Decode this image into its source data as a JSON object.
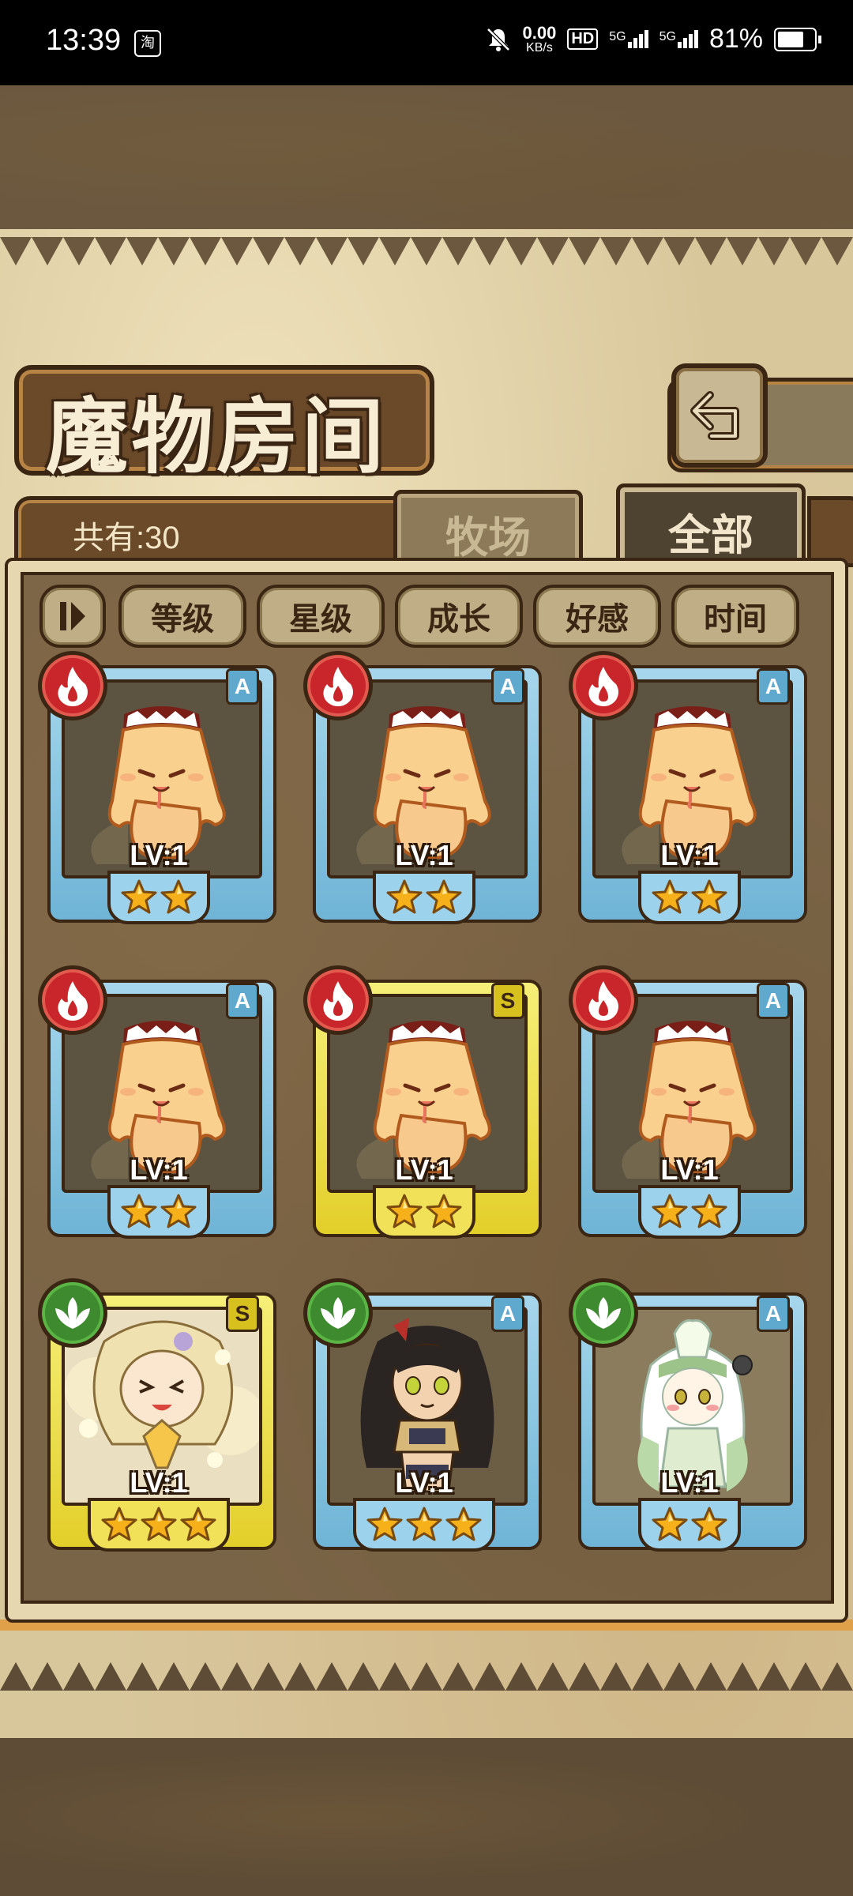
{
  "status_bar": {
    "time": "13:39",
    "app_badge": "淘",
    "net_speed_value": "0.00",
    "net_speed_unit": "KB/s",
    "hd_label": "HD",
    "signal_1": "5G",
    "signal_2": "5G",
    "battery": "81%",
    "battery_fraction": 0.81
  },
  "header": {
    "title": "魔物房间",
    "back_icon": "return-arrow-icon"
  },
  "tabs": {
    "count_label": "共有:30",
    "ranch": "牧场",
    "all": "全部",
    "active": "all"
  },
  "sort": {
    "toggle_icon": "sort-toggle-icon",
    "buttons": [
      "等级",
      "星级",
      "成长",
      "好感",
      "时间"
    ]
  },
  "monsters": [
    {
      "rank": "A",
      "element": "fire",
      "level": "LV:1",
      "stars": 2,
      "character": "pudding-slime"
    },
    {
      "rank": "A",
      "element": "fire",
      "level": "LV:1",
      "stars": 2,
      "character": "pudding-slime"
    },
    {
      "rank": "A",
      "element": "fire",
      "level": "LV:1",
      "stars": 2,
      "character": "pudding-slime"
    },
    {
      "rank": "A",
      "element": "fire",
      "level": "LV:1",
      "stars": 2,
      "character": "pudding-slime"
    },
    {
      "rank": "S",
      "element": "fire",
      "level": "LV:1",
      "stars": 2,
      "character": "pudding-slime"
    },
    {
      "rank": "A",
      "element": "fire",
      "level": "LV:1",
      "stars": 2,
      "character": "pudding-slime"
    },
    {
      "rank": "S",
      "element": "grass",
      "level": "LV:1",
      "stars": 3,
      "character": "golden-fairy"
    },
    {
      "rank": "A",
      "element": "grass",
      "level": "LV:1",
      "stars": 3,
      "character": "dark-haired-girl"
    },
    {
      "rank": "A",
      "element": "grass",
      "level": "LV:1",
      "stars": 2,
      "character": "scallion-girl"
    }
  ],
  "colors": {
    "fire": "#c8262b",
    "grass": "#3e8a2f",
    "rank_A": "#a6d6ec",
    "rank_S": "#f6ef78",
    "star": "#f5b01a"
  }
}
